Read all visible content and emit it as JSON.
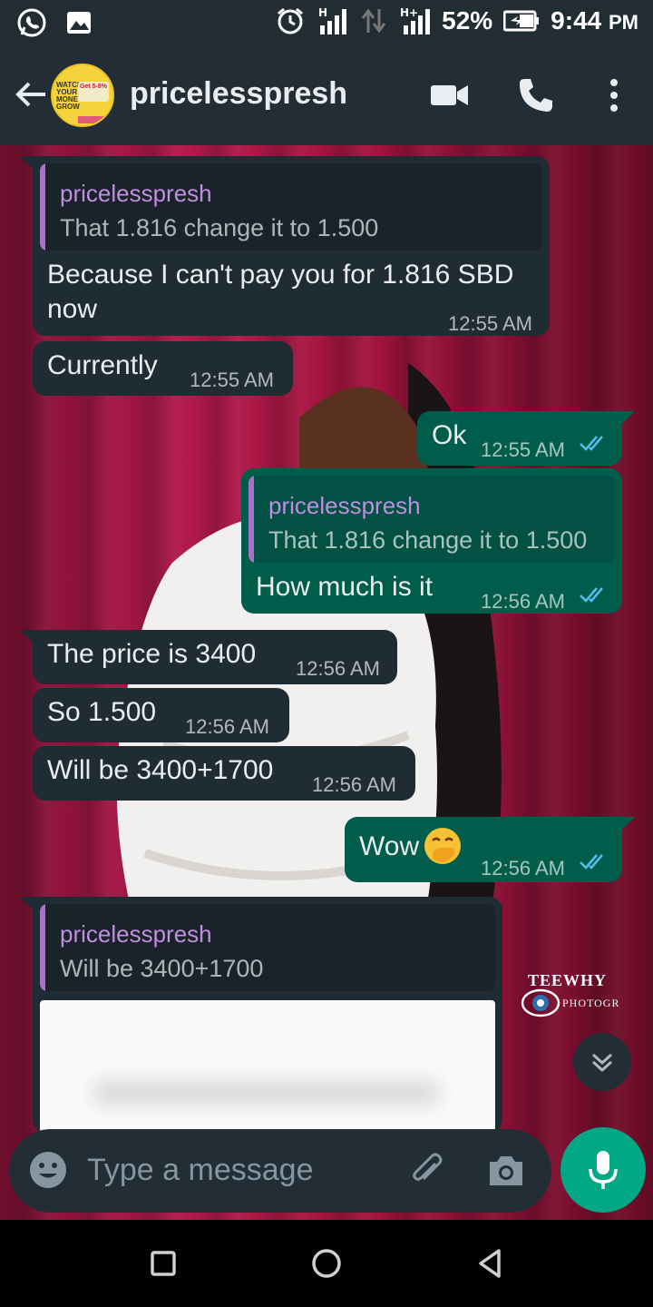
{
  "status_bar": {
    "battery": "52%",
    "time": "9:44",
    "ampm": "PM",
    "icons": [
      "whatsapp-icon",
      "image-icon",
      "alarm-icon",
      "signal-h-icon",
      "data-arrows-icon",
      "signal-hplus-icon",
      "battery-charging-icon"
    ]
  },
  "header": {
    "contact_name": "pricelesspresh",
    "icons": [
      "back-arrow-icon",
      "video-call-icon",
      "voice-call-icon",
      "more-vert-icon"
    ],
    "avatar_text": {
      "line1": "WATCH",
      "line2": "YOUR",
      "line3": "MONEY",
      "line4": "GROW",
      "badge": "Get 5-8%"
    }
  },
  "messages": [
    {
      "direction": "in",
      "quote": {
        "name": "pricelesspresh",
        "text": "That 1.816 change it to 1.500"
      },
      "text_line1": "Because I can't pay you for 1.816 SBD",
      "text_line2": "now",
      "time": "12:55 AM"
    },
    {
      "direction": "in",
      "text": "Currently",
      "time": "12:55 AM"
    },
    {
      "direction": "out",
      "text": "Ok",
      "time": "12:55 AM",
      "status": "read"
    },
    {
      "direction": "out",
      "quote": {
        "name": "pricelesspresh",
        "text": "That 1.816 change it to 1.500"
      },
      "text": "How much is it",
      "time": "12:56 AM",
      "status": "read"
    },
    {
      "direction": "in",
      "text": "The price is 3400",
      "time": "12:56 AM"
    },
    {
      "direction": "in",
      "text": "So 1.500",
      "time": "12:56 AM"
    },
    {
      "direction": "in",
      "text": "Will be 3400+1700",
      "time": "12:56 AM"
    },
    {
      "direction": "out",
      "text": "Wow",
      "emoji": "🤭",
      "time": "12:56 AM",
      "status": "read"
    },
    {
      "direction": "in",
      "quote": {
        "name": "pricelesspresh",
        "text": "Will be 3400+1700"
      },
      "attachment": "blurred-image"
    }
  ],
  "watermark": {
    "line1": "TEEWHY",
    "line2": "PHOTOGRAPHY"
  },
  "input": {
    "placeholder": "Type a message",
    "icons": [
      "emoji-icon",
      "attach-icon",
      "camera-icon",
      "mic-icon"
    ]
  },
  "navbar": {
    "icons": [
      "recents-icon",
      "home-icon",
      "back-icon"
    ]
  },
  "colors": {
    "header_bg": "#232d36",
    "incoming_bubble": "#202c33",
    "outgoing_bubble": "#005c4b",
    "quote_name": "#c08ee0",
    "read_ticks": "#53bdeb",
    "mic_button": "#00a884"
  }
}
